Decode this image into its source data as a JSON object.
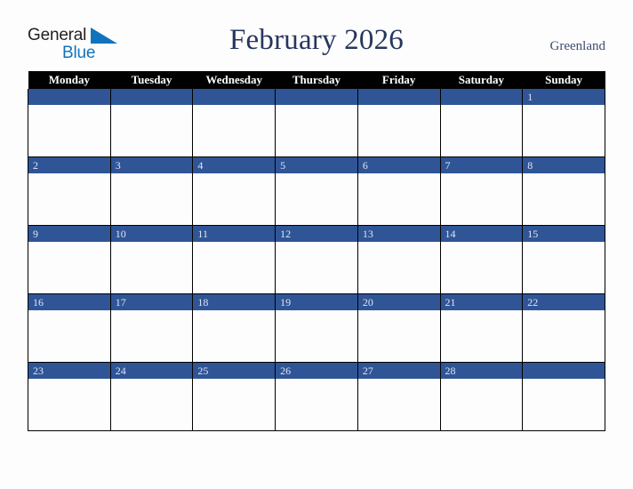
{
  "brand": {
    "name_part1": "General",
    "name_part2": "Blue",
    "color_dark": "#231f20",
    "color_blue": "#1273bd"
  },
  "header": {
    "title": "February 2026",
    "region": "Greenland",
    "title_color": "#27365c",
    "region_color": "#3d4d70"
  },
  "calendar": {
    "accent_color": "#2f5597",
    "header_bg": "#010101",
    "header_text_color": "#ffffff",
    "weekday_headers": [
      "Monday",
      "Tuesday",
      "Wednesday",
      "Thursday",
      "Friday",
      "Saturday",
      "Sunday"
    ],
    "weeks": [
      [
        {
          "day": ""
        },
        {
          "day": ""
        },
        {
          "day": ""
        },
        {
          "day": ""
        },
        {
          "day": ""
        },
        {
          "day": ""
        },
        {
          "day": "1"
        }
      ],
      [
        {
          "day": "2"
        },
        {
          "day": "3"
        },
        {
          "day": "4"
        },
        {
          "day": "5"
        },
        {
          "day": "6"
        },
        {
          "day": "7"
        },
        {
          "day": "8"
        }
      ],
      [
        {
          "day": "9"
        },
        {
          "day": "10"
        },
        {
          "day": "11"
        },
        {
          "day": "12"
        },
        {
          "day": "13"
        },
        {
          "day": "14"
        },
        {
          "day": "15"
        }
      ],
      [
        {
          "day": "16"
        },
        {
          "day": "17"
        },
        {
          "day": "18"
        },
        {
          "day": "19"
        },
        {
          "day": "20"
        },
        {
          "day": "21"
        },
        {
          "day": "22"
        }
      ],
      [
        {
          "day": "23"
        },
        {
          "day": "24"
        },
        {
          "day": "25"
        },
        {
          "day": "26"
        },
        {
          "day": "27"
        },
        {
          "day": "28"
        },
        {
          "day": ""
        }
      ]
    ]
  }
}
